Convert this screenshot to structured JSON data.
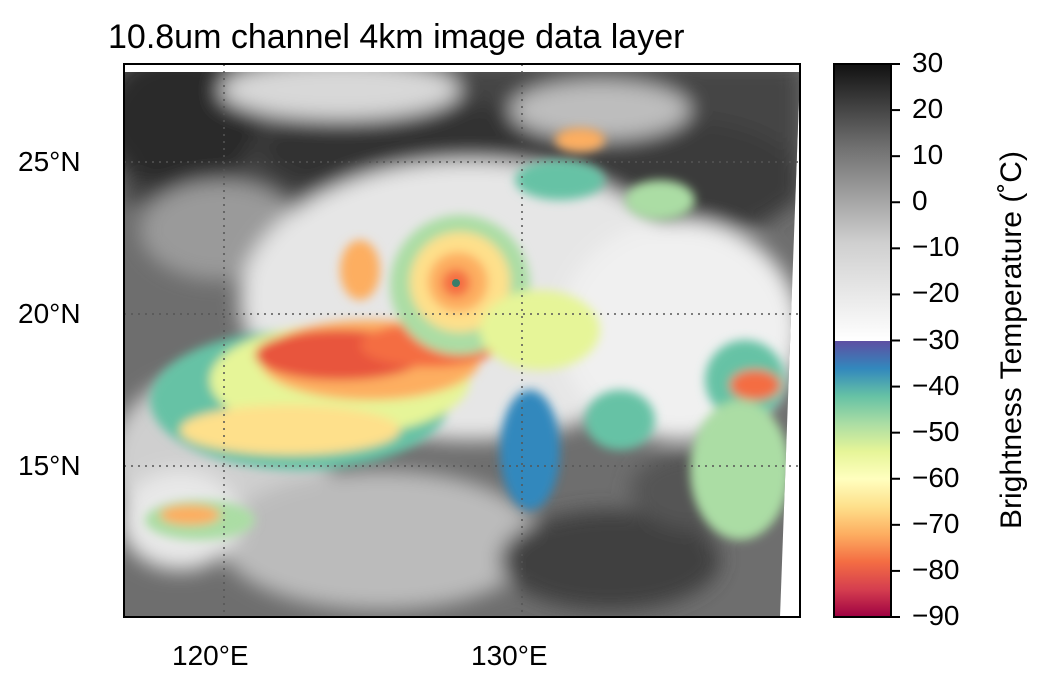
{
  "title": "10.8um channel 4km image data layer",
  "axes": {
    "lat_labels": [
      "25°N",
      "20°N",
      "15°N"
    ],
    "lon_labels": [
      "120°E",
      "130°E"
    ]
  },
  "colorbar": {
    "label": "Brightness Temperature (˚C)",
    "ticks": [
      "30",
      "20",
      "10",
      "0",
      "−10",
      "−20",
      "−30",
      "−40",
      "−50",
      "−60",
      "−70",
      "−80",
      "−90"
    ],
    "range": [
      -90,
      30
    ],
    "split_value": -30,
    "cold_colormap": "Spectral",
    "warm_colormap": "Greys"
  },
  "chart_data": {
    "type": "heatmap",
    "title": "10.8um channel 4km image data layer",
    "variable": "Brightness Temperature (˚C)",
    "lon_ticks": [
      120,
      130
    ],
    "lat_ticks": [
      15,
      20,
      25
    ],
    "lon_range": [
      117,
      138.5
    ],
    "lat_range": [
      10,
      28
    ],
    "value_range": [
      -90,
      30
    ],
    "grid": true,
    "features": [
      {
        "type": "storm-eye",
        "lon": 127.5,
        "lat": 21
      },
      {
        "type": "cold-band",
        "lon": 123.5,
        "lat": 19
      }
    ]
  }
}
